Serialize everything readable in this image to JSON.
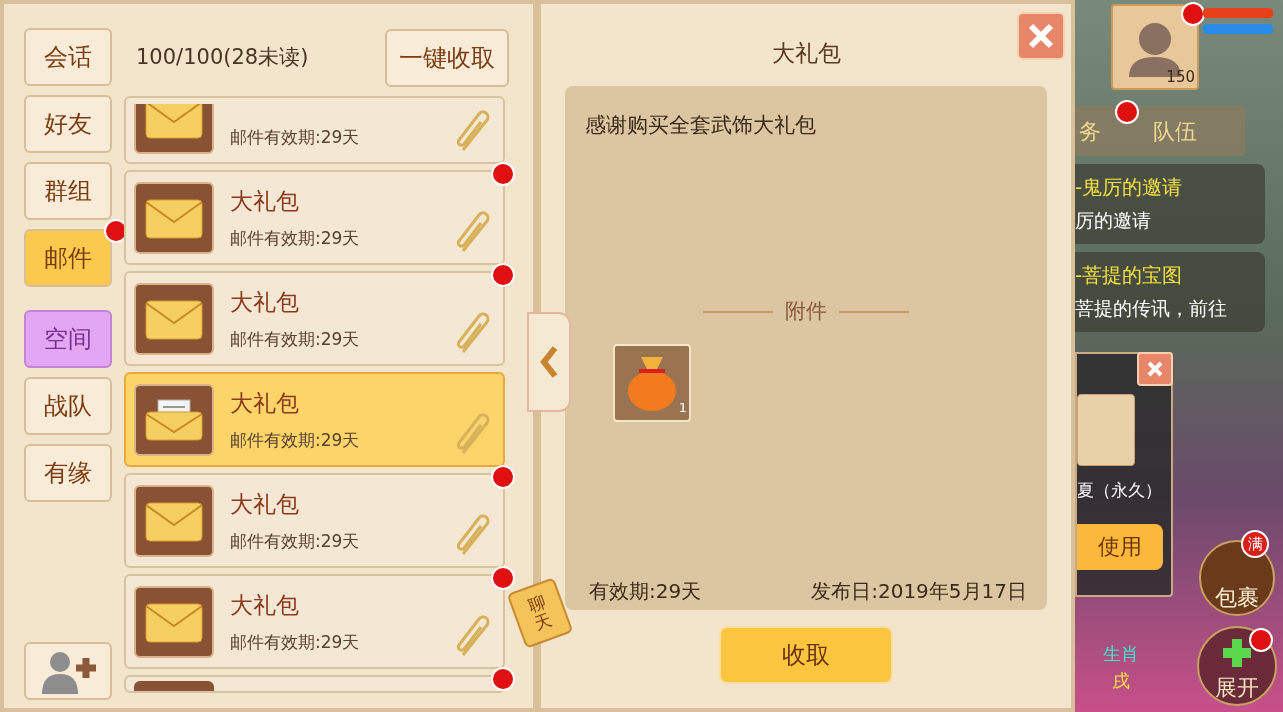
{
  "sidebar": {
    "tabs": [
      {
        "label": "会话",
        "selected": false,
        "badge": false,
        "kind": "normal"
      },
      {
        "label": "好友",
        "selected": false,
        "badge": false,
        "kind": "normal"
      },
      {
        "label": "群组",
        "selected": false,
        "badge": false,
        "kind": "normal"
      },
      {
        "label": "邮件",
        "selected": true,
        "badge": true,
        "kind": "normal"
      },
      {
        "label": "空间",
        "selected": false,
        "badge": false,
        "kind": "special"
      },
      {
        "label": "战队",
        "selected": false,
        "badge": false,
        "kind": "normal"
      },
      {
        "label": "有缘",
        "selected": false,
        "badge": false,
        "kind": "normal"
      }
    ]
  },
  "mail": {
    "count": "100/100(28未读)",
    "collect_all": "一键收取",
    "items": [
      {
        "kind": "partial-top",
        "validity": "邮件有效期:29天",
        "unread": false,
        "selected": false
      },
      {
        "kind": "full",
        "title": "大礼包",
        "validity": "邮件有效期:29天",
        "unread": true,
        "selected": false
      },
      {
        "kind": "full",
        "title": "大礼包",
        "validity": "邮件有效期:29天",
        "unread": true,
        "selected": false
      },
      {
        "kind": "full",
        "title": "大礼包",
        "validity": "邮件有效期:29天",
        "unread": false,
        "selected": true
      },
      {
        "kind": "full",
        "title": "大礼包",
        "validity": "邮件有效期:29天",
        "unread": true,
        "selected": false
      },
      {
        "kind": "full",
        "title": "大礼包",
        "validity": "邮件有效期:29天",
        "unread": true,
        "selected": false
      },
      {
        "kind": "partial-bottom",
        "unread": true,
        "selected": false
      }
    ]
  },
  "detail": {
    "title": "大礼包",
    "message": "感谢购买全套武饰大礼包",
    "attachments_label": "附件",
    "attachment_count": "1",
    "validity": "有效期:29天",
    "published": "发布日:2019年5月17日",
    "collect": "收取",
    "chat_tag": "聊天"
  },
  "hud": {
    "level": "150",
    "task_tab": "务",
    "team_tab": "队伍",
    "quests": [
      {
        "title": "-鬼厉的邀请",
        "desc": "厉的邀请"
      },
      {
        "title": "-菩提的宝图",
        "desc": "菩提的传讯，前往"
      }
    ],
    "reward_name": "夏（永久）",
    "use_button": "使用",
    "bag": "包裹",
    "bag_badge": "满",
    "expand": "展开",
    "zodiac_label": "生肖",
    "zodiac_value": "戌"
  }
}
